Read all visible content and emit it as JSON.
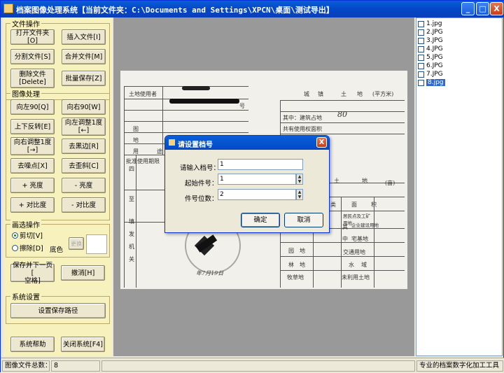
{
  "window": {
    "title": "档案图像处理系统【当前文件夹：C:\\Documents and Settings\\XPCN\\桌面\\测试导出】",
    "controls": {
      "minimize": "_",
      "maximize": "□",
      "close": "X"
    }
  },
  "left": {
    "file_ops": {
      "title": "文件操作",
      "open": "打开文件夹[O]",
      "insert": "插入文件[I]",
      "split": "分割文件[S]",
      "merge": "合并文件[M]",
      "delete": "删除文件\n[Delete]",
      "batch_save": "批量保存[Z]"
    },
    "image_ops": {
      "title": "图像处理",
      "rot_left": "向左90[Q]",
      "rot_right": "向右90[W]",
      "flip": "上下反转[E]",
      "adj_left": "向左调整1度\n[←]",
      "adj_right": "向右调整1度\n[→]",
      "remove_black": "去黑边[R]",
      "denoise": "去噪点[X]",
      "deskew": "去歪斜[C]",
      "bright_up": "+ 亮度",
      "bright_down": "- 亮度",
      "contrast_up": "+ 对比度",
      "contrast_down": "- 对比度"
    },
    "select_ops": {
      "title": "画选操作",
      "cut": "剪切[V]",
      "erase": "擦除[D]",
      "bg_label": "底色",
      "change": "更换"
    },
    "save_next": "保存并下一页 [\n空格]",
    "undo": "撤消[H]",
    "sys": {
      "title": "系统设置",
      "path": "设置保存路径"
    },
    "help": "系统帮助",
    "close": "关闭系统[F4]"
  },
  "files": [
    {
      "name": "1.jpg",
      "selected": false
    },
    {
      "name": "2.JPG",
      "selected": false
    },
    {
      "name": "3.JPG",
      "selected": false
    },
    {
      "name": "4.JPG",
      "selected": false
    },
    {
      "name": "5.JPG",
      "selected": false
    },
    {
      "name": "6.JPG",
      "selected": false
    },
    {
      "name": "7.JPG",
      "selected": false
    },
    {
      "name": "8.jpg",
      "selected": true
    }
  ],
  "doc": {
    "t1": "土地使用者",
    "t2": "图",
    "t3": "地",
    "t4": "用",
    "t5": "批准使用期限",
    "t6": "城",
    "t7": "镇",
    "t8": "土",
    "t9": "地",
    "t10": "(平方米)",
    "t11": "其中：建筑占地",
    "t12": "共有使用权面积",
    "t13": "土",
    "t14": "地",
    "t15": "(亩)",
    "t16": "类",
    "t17": "面",
    "t18": "积",
    "t19": "居民点及工矿用地",
    "t20": "其",
    "t21": "企业建设用地",
    "t22": "中",
    "t23": "宅基地",
    "t24": "交通用地",
    "t25": "园",
    "t26": "地",
    "t27": "林",
    "t28": "地",
    "t29": "水",
    "t30": "域",
    "t31": "牧草地",
    "t32": "未利用土地",
    "t33": "四",
    "t34": "至",
    "t35": "填",
    "t36": "发",
    "t37": "机",
    "t38": "关",
    "t39": "年7月19日",
    "t40": "80",
    "t41": "号",
    "t42": "途"
  },
  "dialog": {
    "title": "请设置档号",
    "close": "X",
    "label1": "请输入档号：",
    "value1": "1",
    "label2": "起始件号：",
    "value2": "1",
    "label3": "件号位数：",
    "value3": "2",
    "ok": "确定",
    "cancel": "取消"
  },
  "status": {
    "label": "图像文件总数：",
    "count": "8",
    "app": "专业的档案数字化加工工具"
  }
}
